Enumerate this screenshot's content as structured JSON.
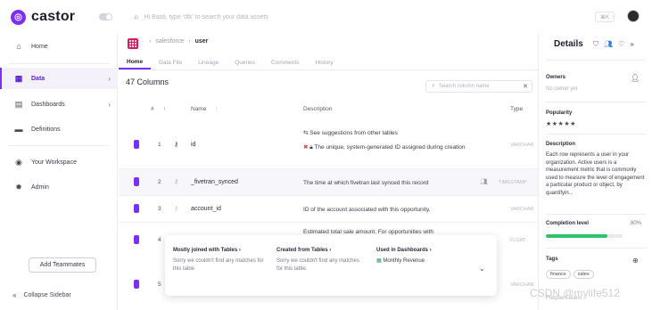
{
  "topbar": {
    "logo_text": "castor",
    "search_placeholder": "Hi Basti, type 'dtk' to search your data assets",
    "shortcut": "⌘K"
  },
  "sidebar": {
    "items": [
      {
        "label": "Home",
        "icon": "home-icon",
        "active": false,
        "chevron": false
      },
      {
        "label": "Data",
        "icon": "database-icon",
        "active": true,
        "chevron": true
      },
      {
        "label": "Dashboards",
        "icon": "dashboard-icon",
        "active": false,
        "chevron": true
      },
      {
        "label": "Definitions",
        "icon": "book-icon",
        "active": false,
        "chevron": false
      },
      {
        "label": "Your Workspace",
        "icon": "user-icon",
        "active": false,
        "chevron": false
      },
      {
        "label": "Admin",
        "icon": "gear-icon",
        "active": false,
        "chevron": false
      }
    ],
    "add_teammates": "Add Teammates",
    "collapse": "Collapse Sidebar"
  },
  "main": {
    "breadcrumb": {
      "parent": "salesforce",
      "current": "user"
    },
    "tabs": [
      "Home",
      "Data File",
      "Lineage",
      "Queries",
      "Comments",
      "History"
    ],
    "active_tab": "Home",
    "column_count": "47 Columns",
    "column_search_placeholder": "Search column name",
    "headers": {
      "hash": "#",
      "name": "Name",
      "description": "Description",
      "type": "Type"
    },
    "rows": [
      {
        "num": "1",
        "name": "id",
        "suggest": "See suggestions from other tables",
        "desc": "The unique, system-generated ID assigned during creation",
        "type": "VARCHAR"
      },
      {
        "num": "2",
        "name": "_fivetran_synced",
        "suggest": "",
        "desc": "The time at which fivetran last synced this record",
        "type": "TIMESTAMP"
      },
      {
        "num": "3",
        "name": "account_id",
        "suggest": "",
        "desc": "ID of the account associated with this opportunity.",
        "type": "VARCHAR"
      },
      {
        "num": "4",
        "name": "",
        "suggest": "",
        "desc": "Estimated total sale amount. For opportunities with",
        "type": "FLOAT"
      },
      {
        "num": "5",
        "name": "",
        "suggest": "",
        "desc": "",
        "type": "VARCHAR"
      }
    ],
    "popover": {
      "joined_title": "Mostly joined with Tables",
      "joined_body": "Sorry we couldn't find any matches for this table",
      "created_title": "Created from Tables",
      "created_body": "Sorry we couldn't find any matches for this table.",
      "dash_title": "Used in Dashboards",
      "dash_item": "Monthly Revenue"
    }
  },
  "details": {
    "title": "Details",
    "owners_label": "Owners",
    "owners_value": "No owner yet",
    "popularity_label": "Popularity",
    "popularity_stars": "★★★★★",
    "description_label": "Description",
    "description_text": "Each row represents a user in your organization. Active users is a measurement metric that is commonly used to measure the level of engagement a particular product or object, by quantifyin...",
    "completion_label": "Completion level",
    "completion_pct": "80%",
    "completion_value": 0.8,
    "tags_label": "Tags",
    "tags": [
      "finance",
      "sales"
    ],
    "frequent_label": "Frequent users"
  },
  "watermark": "CSDN @mylife512",
  "colors": {
    "accent": "#7b2ff7",
    "table_icon": "#d81b60",
    "progress": "#2ec26b"
  }
}
